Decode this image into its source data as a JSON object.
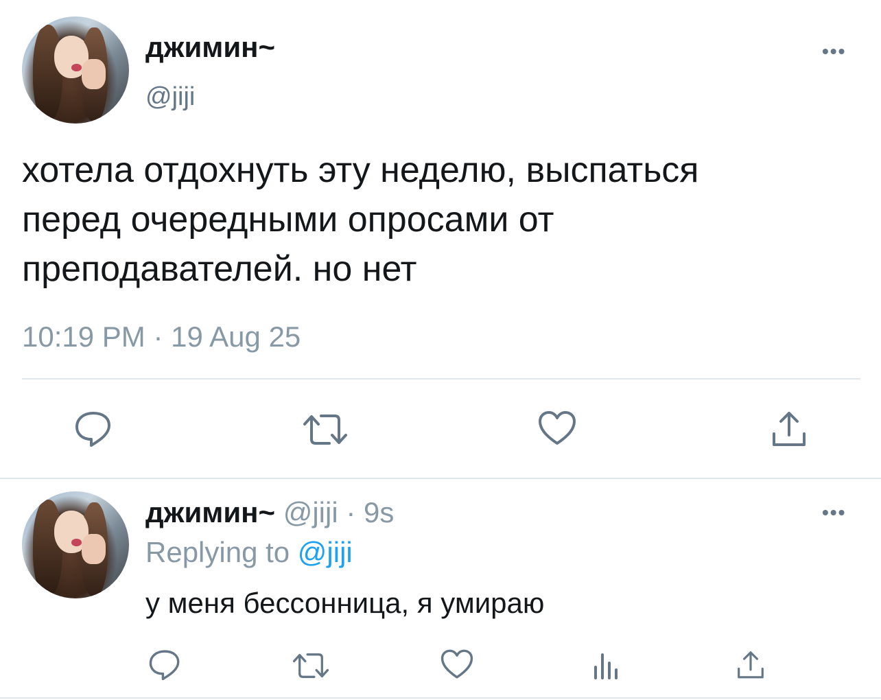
{
  "main_tweet": {
    "display_name": "джимин~",
    "handle": "@jiji",
    "text_lines": [
      "хотела отдохнуть эту неделю, выспаться",
      "перед очередными опросами от",
      "преподавателей. но нет"
    ],
    "timestamp": "10:19 PM · 19 Aug 25",
    "more_label": "•••",
    "actions": [
      "reply-icon",
      "retweet-icon",
      "like-icon",
      "share-icon"
    ]
  },
  "reply_tweet": {
    "display_name": "джимин~",
    "meta": "@jiji · 9s",
    "replying_prefix": "Replying to",
    "replying_handle": "@jiji",
    "text": "у меня бессонница, я умираю",
    "more_label": "•••",
    "actions": [
      "reply-icon",
      "retweet-icon",
      "like-icon",
      "analytics-icon",
      "share-icon"
    ]
  },
  "colors": {
    "text": "#14171a",
    "secondary": "#657786",
    "link": "#1da1f2",
    "divider": "#e1e8ed"
  }
}
